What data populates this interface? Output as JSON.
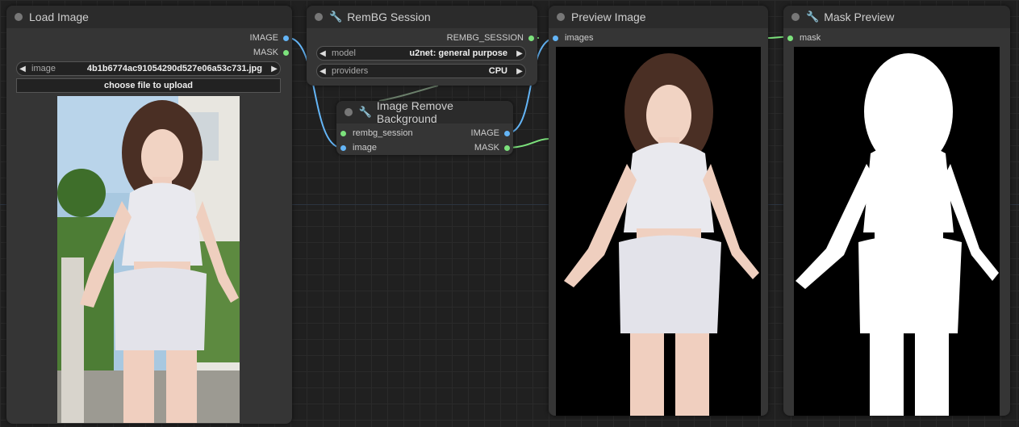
{
  "nodes": {
    "load_image": {
      "title": "Load Image",
      "outputs": [
        "IMAGE",
        "MASK"
      ],
      "image_widget": {
        "label": "image",
        "value": "4b1b6774ac91054290d527e06a53c731.jpg"
      },
      "upload_button": "choose file to upload"
    },
    "rembg_session": {
      "title": "RemBG Session",
      "output": "REMBG_SESSION",
      "model_widget": {
        "label": "model",
        "value": "u2net: general purpose"
      },
      "providers_widget": {
        "label": "providers",
        "value": "CPU"
      }
    },
    "image_remove_bg": {
      "title": "Image Remove Background",
      "inputs": [
        "rembg_session",
        "image"
      ],
      "outputs": [
        "IMAGE",
        "MASK"
      ]
    },
    "preview_image": {
      "title": "Preview Image",
      "input": "images"
    },
    "mask_preview": {
      "title": "Mask Preview",
      "input": "mask"
    }
  },
  "colors": {
    "image_port": "#64b5f6",
    "mask_port": "#7ce27c",
    "node_bg": "#353535",
    "canvas_bg": "#202020"
  },
  "icons": {
    "node_status": "circle-dot-icon",
    "custom_node": "wrench-icon",
    "widget_left": "triangle-left-icon",
    "widget_right": "triangle-right-icon"
  }
}
